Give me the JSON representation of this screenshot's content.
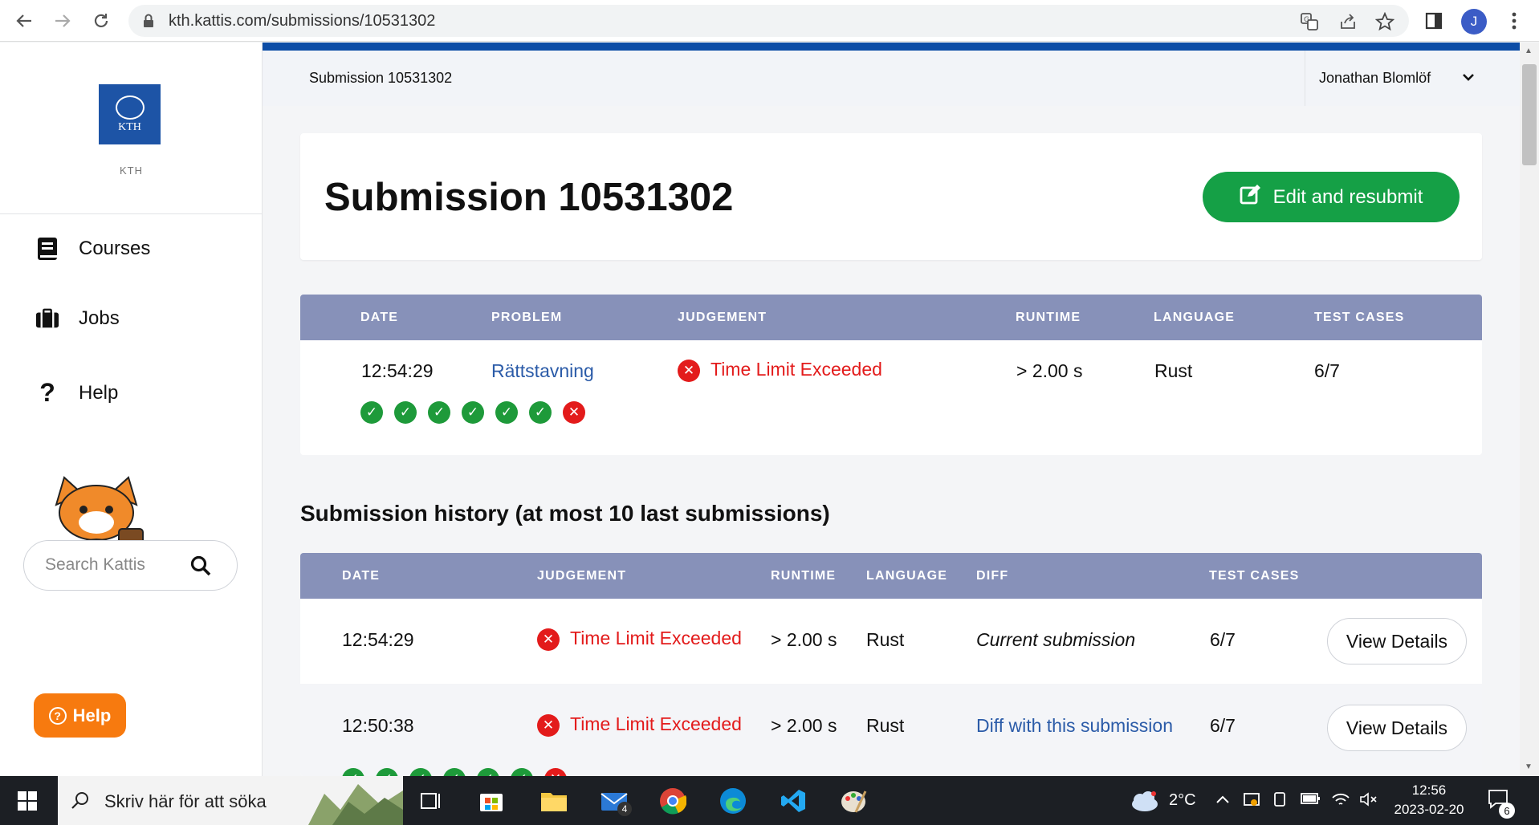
{
  "browser": {
    "url": "kth.kattis.com/submissions/10531302",
    "profile_initial": "J"
  },
  "sidebar": {
    "org_name": "KTH",
    "logo_text": "KTH",
    "items": [
      {
        "label": "Courses"
      },
      {
        "label": "Jobs"
      },
      {
        "label": "Help"
      }
    ],
    "search_placeholder": "Search Kattis",
    "help_button": "Help"
  },
  "topbar": {
    "breadcrumb": "Submission 10531302",
    "user": "Jonathan Blomlöf"
  },
  "header": {
    "title": "Submission 10531302",
    "edit_button": "Edit and resubmit"
  },
  "submission_table": {
    "headers": [
      "DATE",
      "PROBLEM",
      "JUDGEMENT",
      "RUNTIME",
      "LANGUAGE",
      "TEST CASES"
    ],
    "row": {
      "date": "12:54:29",
      "problem": "Rättstavning",
      "judgement": "Time Limit Exceeded",
      "runtime": "> 2.00 s",
      "language": "Rust",
      "test_cases": "6/7",
      "test_results": [
        "pass",
        "pass",
        "pass",
        "pass",
        "pass",
        "pass",
        "fail"
      ]
    }
  },
  "history": {
    "title": "Submission history (at most 10 last submissions)",
    "headers": [
      "DATE",
      "JUDGEMENT",
      "RUNTIME",
      "LANGUAGE",
      "DIFF",
      "TEST CASES"
    ],
    "rows": [
      {
        "date": "12:54:29",
        "judgement": "Time Limit Exceeded",
        "runtime": "> 2.00 s",
        "language": "Rust",
        "diff": "Current submission",
        "test_cases": "6/7",
        "button": "View Details"
      },
      {
        "date": "12:50:38",
        "judgement": "Time Limit Exceeded",
        "runtime": "> 2.00 s",
        "language": "Rust",
        "diff": "Diff with this submission",
        "test_cases": "6/7",
        "button": "View Details"
      }
    ]
  },
  "taskbar": {
    "search_placeholder": "Skriv här för att söka",
    "mail_badge": "4",
    "temperature": "2°C",
    "time": "12:56",
    "date": "2023-02-20",
    "notification_count": "6"
  },
  "colors": {
    "brand_blue": "#0d4da6",
    "table_header": "#8791b9",
    "success_green": "#15a046",
    "fail_red": "#e31b1b",
    "help_orange": "#f77a0f"
  }
}
